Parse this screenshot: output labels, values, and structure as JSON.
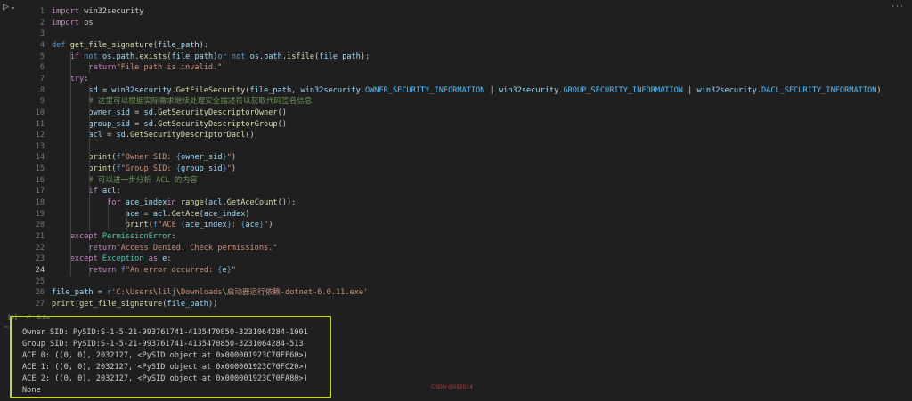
{
  "toolbar": {
    "more_label": "···"
  },
  "code": [
    {
      "n": "1",
      "tokens": [
        [
          "kw",
          "import"
        ],
        [
          "",
          "win32security"
        ]
      ]
    },
    {
      "n": "2",
      "tokens": [
        [
          "kw",
          "import"
        ],
        [
          "",
          "os"
        ]
      ]
    },
    {
      "n": "3",
      "tokens": []
    },
    {
      "n": "4",
      "tokens": [
        [
          "kw2",
          "def"
        ],
        [
          "fn",
          "get_file_signature"
        ],
        [
          "",
          "("
        ],
        [
          "var",
          "file_path"
        ],
        [
          "",
          "):"
        ]
      ]
    },
    {
      "n": "5",
      "tokens": [
        [
          "",
          "    "
        ],
        [
          "kw",
          "if"
        ],
        [
          "kw2",
          "not"
        ],
        [
          "var",
          "os"
        ],
        [
          "",
          "."
        ],
        [
          "var",
          "path"
        ],
        [
          "",
          "."
        ],
        [
          "fn",
          "exists"
        ],
        [
          "",
          "("
        ],
        [
          "var",
          "file_path"
        ],
        [
          "",
          ")"
        ],
        [
          "kw2",
          "or"
        ],
        [
          "kw2",
          "not"
        ],
        [
          "var",
          "os"
        ],
        [
          "",
          "."
        ],
        [
          "var",
          "path"
        ],
        [
          "",
          "."
        ],
        [
          "fn",
          "isfile"
        ],
        [
          "",
          "("
        ],
        [
          "var",
          "file_path"
        ],
        [
          "",
          "):"
        ]
      ]
    },
    {
      "n": "6",
      "tokens": [
        [
          "",
          "        "
        ],
        [
          "kw",
          "return"
        ],
        [
          "str",
          "\"File path is invalid.\""
        ]
      ]
    },
    {
      "n": "7",
      "tokens": [
        [
          "",
          "    "
        ],
        [
          "kw",
          "try"
        ],
        [
          "",
          ":"
        ]
      ]
    },
    {
      "n": "8",
      "tokens": [
        [
          "",
          "        "
        ],
        [
          "var",
          "sd"
        ],
        [
          "",
          " = "
        ],
        [
          "var",
          "win32security"
        ],
        [
          "",
          "."
        ],
        [
          "fn",
          "GetFileSecurity"
        ],
        [
          "",
          "("
        ],
        [
          "var",
          "file_path"
        ],
        [
          "",
          ", "
        ],
        [
          "var",
          "win32security"
        ],
        [
          "",
          "."
        ],
        [
          "const",
          "OWNER_SECURITY_INFORMATION"
        ],
        [
          "",
          " | "
        ],
        [
          "var",
          "win32security"
        ],
        [
          "",
          "."
        ],
        [
          "const",
          "GROUP_SECURITY_INFORMATION"
        ],
        [
          "",
          " | "
        ],
        [
          "var",
          "win32security"
        ],
        [
          "",
          "."
        ],
        [
          "const",
          "DACL_SECURITY_INFORMATION"
        ],
        [
          "",
          ")"
        ]
      ]
    },
    {
      "n": "9",
      "tokens": [
        [
          "",
          "        "
        ],
        [
          "cm",
          "# 这里可以根据实际需求继续处理安全描述符以获取代码签名信息"
        ]
      ]
    },
    {
      "n": "10",
      "tokens": [
        [
          "",
          "        "
        ],
        [
          "var",
          "owner_sid"
        ],
        [
          "",
          " = "
        ],
        [
          "var",
          "sd"
        ],
        [
          "",
          "."
        ],
        [
          "fn",
          "GetSecurityDescriptorOwner"
        ],
        [
          "",
          "()"
        ]
      ]
    },
    {
      "n": "11",
      "tokens": [
        [
          "",
          "        "
        ],
        [
          "var",
          "group_sid"
        ],
        [
          "",
          " = "
        ],
        [
          "var",
          "sd"
        ],
        [
          "",
          "."
        ],
        [
          "fn",
          "GetSecurityDescriptorGroup"
        ],
        [
          "",
          "()"
        ]
      ]
    },
    {
      "n": "12",
      "tokens": [
        [
          "",
          "        "
        ],
        [
          "var",
          "acl"
        ],
        [
          "",
          " = "
        ],
        [
          "var",
          "sd"
        ],
        [
          "",
          "."
        ],
        [
          "fn",
          "GetSecurityDescriptorDacl"
        ],
        [
          "",
          "()"
        ]
      ]
    },
    {
      "n": "13",
      "tokens": []
    },
    {
      "n": "14",
      "tokens": [
        [
          "",
          "        "
        ],
        [
          "fn",
          "print"
        ],
        [
          "",
          "("
        ],
        [
          "kw2",
          "f"
        ],
        [
          "str",
          "\"Owner SID: "
        ],
        [
          "brace",
          "{"
        ],
        [
          "var",
          "owner_sid"
        ],
        [
          "brace",
          "}"
        ],
        [
          "str",
          "\""
        ],
        [
          "",
          ")"
        ]
      ]
    },
    {
      "n": "15",
      "tokens": [
        [
          "",
          "        "
        ],
        [
          "fn",
          "print"
        ],
        [
          "",
          "("
        ],
        [
          "kw2",
          "f"
        ],
        [
          "str",
          "\"Group SID: "
        ],
        [
          "brace",
          "{"
        ],
        [
          "var",
          "group_sid"
        ],
        [
          "brace",
          "}"
        ],
        [
          "str",
          "\""
        ],
        [
          "",
          ")"
        ]
      ]
    },
    {
      "n": "16",
      "tokens": [
        [
          "",
          "        "
        ],
        [
          "cm",
          "# 可以进一步分析 ACL 的内容"
        ]
      ]
    },
    {
      "n": "17",
      "tokens": [
        [
          "",
          "        "
        ],
        [
          "kw",
          "if"
        ],
        [
          "var",
          "acl"
        ],
        [
          "",
          ":"
        ]
      ]
    },
    {
      "n": "18",
      "tokens": [
        [
          "",
          "            "
        ],
        [
          "kw",
          "for"
        ],
        [
          "var",
          "ace_index"
        ],
        [
          "kw",
          "in"
        ],
        [
          "fn",
          "range"
        ],
        [
          "",
          "("
        ],
        [
          "var",
          "acl"
        ],
        [
          "",
          "."
        ],
        [
          "fn",
          "GetAceCount"
        ],
        [
          "",
          "()):"
        ]
      ]
    },
    {
      "n": "19",
      "tokens": [
        [
          "",
          "                "
        ],
        [
          "var",
          "ace"
        ],
        [
          "",
          " = "
        ],
        [
          "var",
          "acl"
        ],
        [
          "",
          "."
        ],
        [
          "fn",
          "GetAce"
        ],
        [
          "",
          "("
        ],
        [
          "var",
          "ace_index"
        ],
        [
          "",
          ")"
        ]
      ]
    },
    {
      "n": "20",
      "tokens": [
        [
          "",
          "                "
        ],
        [
          "fn",
          "print"
        ],
        [
          "",
          "("
        ],
        [
          "kw2",
          "f"
        ],
        [
          "str",
          "\"ACE "
        ],
        [
          "brace",
          "{"
        ],
        [
          "var",
          "ace_index"
        ],
        [
          "brace",
          "}"
        ],
        [
          "str",
          ": "
        ],
        [
          "brace",
          "{"
        ],
        [
          "var",
          "ace"
        ],
        [
          "brace",
          "}"
        ],
        [
          "str",
          "\""
        ],
        [
          "",
          ")"
        ]
      ]
    },
    {
      "n": "21",
      "tokens": [
        [
          "",
          "    "
        ],
        [
          "kw",
          "except"
        ],
        [
          "cls",
          "PermissionError"
        ],
        [
          "",
          ":"
        ]
      ]
    },
    {
      "n": "22",
      "tokens": [
        [
          "",
          "        "
        ],
        [
          "kw",
          "return"
        ],
        [
          "str",
          "\"Access Denied. Check permissions.\""
        ]
      ]
    },
    {
      "n": "23",
      "tokens": [
        [
          "",
          "    "
        ],
        [
          "kw",
          "except"
        ],
        [
          "cls",
          "Exception"
        ],
        [
          "kw",
          "as"
        ],
        [
          "var",
          "e"
        ],
        [
          "",
          ":"
        ]
      ]
    },
    {
      "n": "24",
      "tokens": [
        [
          "",
          "        "
        ],
        [
          "kw",
          "return"
        ],
        [
          "kw2",
          "f"
        ],
        [
          "str",
          "\"An error occurred: "
        ],
        [
          "brace",
          "{"
        ],
        [
          "var",
          "e"
        ],
        [
          "brace",
          "}"
        ],
        [
          "str",
          "\""
        ]
      ]
    },
    {
      "n": "25",
      "tokens": []
    },
    {
      "n": "26",
      "tokens": [
        [
          "var",
          "file_path"
        ],
        [
          "",
          " = "
        ],
        [
          "kw2",
          "r"
        ],
        [
          "str",
          "'C:"
        ],
        [
          "esc",
          "\\"
        ],
        [
          "str",
          "Users"
        ],
        [
          "esc",
          "\\"
        ],
        [
          "str",
          "lilj"
        ],
        [
          "esc",
          "\\"
        ],
        [
          "str",
          "Downloads"
        ],
        [
          "esc",
          "\\"
        ],
        [
          "str",
          "启动器运行依赖-dotnet-6.0.11.exe'"
        ]
      ]
    },
    {
      "n": "27",
      "tokens": [
        [
          "fn",
          "print"
        ],
        [
          "",
          "("
        ],
        [
          "fn",
          "get_file_signature"
        ],
        [
          "",
          "("
        ],
        [
          "var",
          "file_path"
        ],
        [
          "",
          "))"
        ]
      ]
    }
  ],
  "active_line": "24",
  "cell": {
    "index": "[1]",
    "time": "0.0s"
  },
  "output_lines": [
    "Owner SID: PySID:S-1-5-21-993761741-4135470850-3231064284-1001",
    "Group SID: PySID:S-1-5-21-993761741-4135470850-3231064284-513",
    "ACE 0: ((0, 0), 2032127, <PySID object at 0x000001923C70FF60>)",
    "ACE 1: ((0, 0), 2032127, <PySID object at 0x000001923C70FC20>)",
    "ACE 2: ((0, 0), 2032127, <PySID object at 0x000001923C70FA80>)",
    "None"
  ],
  "watermark": "CSDN @lilj2014",
  "colors": {
    "highlight_border": "#c4d62e",
    "background": "#1f1f1f"
  }
}
